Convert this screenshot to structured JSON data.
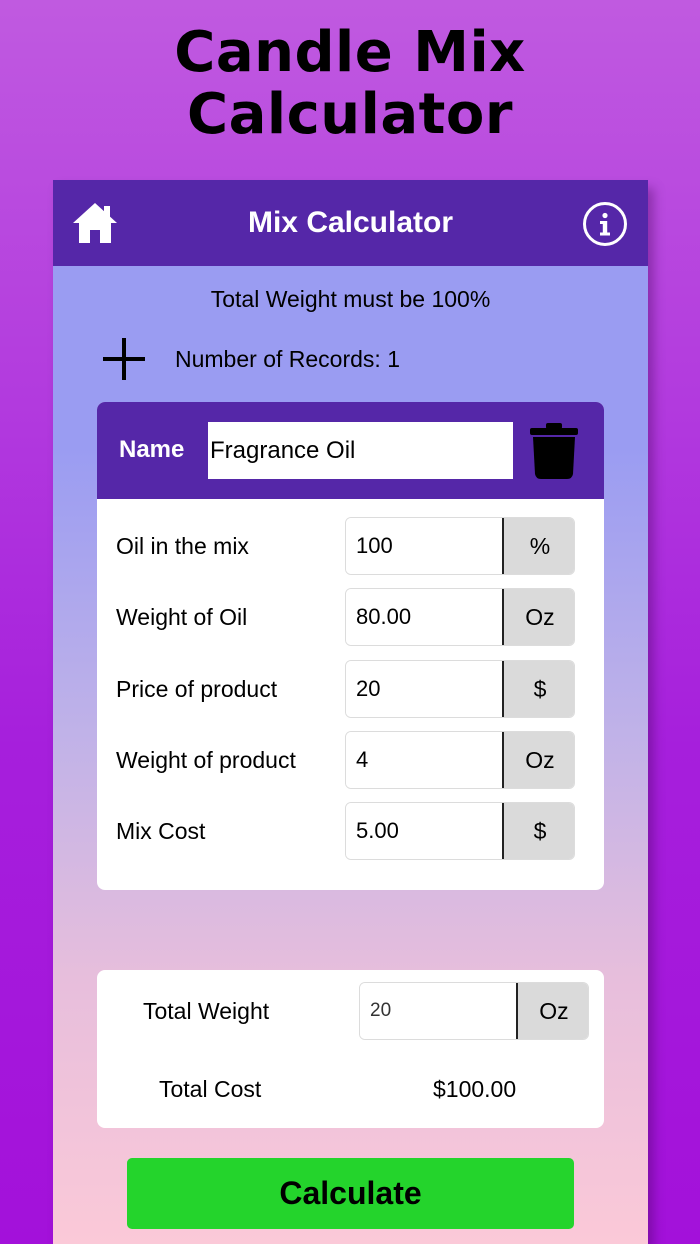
{
  "headline": {
    "line1": "Candle Mix",
    "line2": "Calculator"
  },
  "navbar": {
    "title": "Mix Calculator",
    "left_icon": "home-icon",
    "right_icon": "info-icon"
  },
  "notice": "Total Weight must be 100%",
  "records": {
    "label": "Number of Records: 1",
    "add_icon": "plus-icon"
  },
  "record": {
    "name_label": "Name",
    "name_value": "Fragrance Oil",
    "delete_icon": "trash-icon",
    "fields": [
      {
        "label": "Oil in the mix",
        "value": "100",
        "unit": "%"
      },
      {
        "label": "Weight of Oil",
        "value": "80.00",
        "unit": "Oz"
      },
      {
        "label": "Price of product",
        "value": "20",
        "unit": "$"
      },
      {
        "label": "Weight of product",
        "value": "4",
        "unit": "Oz"
      },
      {
        "label": "Mix Cost",
        "value": "5.00",
        "unit": "$"
      }
    ]
  },
  "totals": {
    "weight_label": "Total Weight",
    "weight_value": "20",
    "weight_unit": "Oz",
    "cost_label": "Total Cost",
    "cost_value": "$100.00"
  },
  "calculate_label": "Calculate",
  "colors": {
    "background": "#b237de",
    "navbar": "#5527a8",
    "button": "#24d42c",
    "unit_box": "#dadada"
  }
}
